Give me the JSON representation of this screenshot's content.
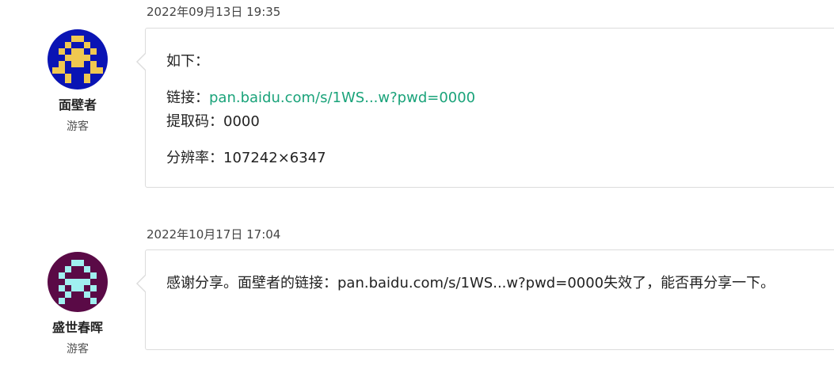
{
  "comments": [
    {
      "timestamp": "2022年09月13日 19:35",
      "author": {
        "name": "面壁者",
        "role": "游客",
        "avatar_icon": "pixel-avatar-icon",
        "avatar_bg": "#0a14b4",
        "avatar_fg": "#f0c850"
      },
      "body": {
        "intro": "如下：",
        "link_label": "链接：",
        "link_text": "pan.baidu.com/s/1WS...w?pwd=0000",
        "code_line": "提取码：0000",
        "resolution_line": "分辨率：107242×6347"
      }
    },
    {
      "timestamp": "2022年10月17日 17:04",
      "author": {
        "name": "盛世春晖",
        "role": "游客",
        "avatar_icon": "pixel-avatar-icon",
        "avatar_bg": "#5a0a46",
        "avatar_fg": "#a0f0f0"
      },
      "body": {
        "text": "感谢分享。面壁者的链接：pan.baidu.com/s/1WS...w?pwd=0000失效了，能否再分享一下。"
      }
    }
  ],
  "colors": {
    "link": "#1aa37a",
    "border": "#dcdcdc"
  }
}
